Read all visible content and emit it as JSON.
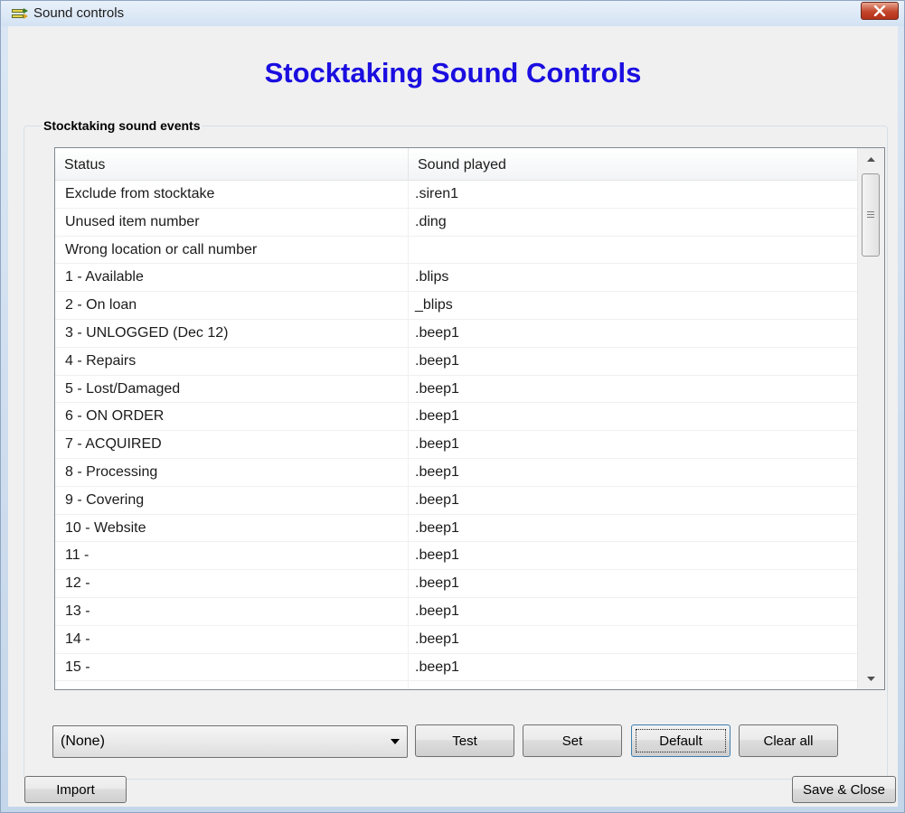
{
  "window": {
    "title": "Sound controls"
  },
  "heading": "Stocktaking Sound Controls",
  "group": {
    "label": "Stocktaking sound events"
  },
  "table": {
    "columns": [
      "Status",
      "Sound played"
    ],
    "rows": [
      {
        "status": "Exclude from stocktake",
        "sound": ".siren1"
      },
      {
        "status": "Unused item number",
        "sound": ".ding"
      },
      {
        "status": "Wrong location or call number",
        "sound": ""
      },
      {
        "status": "1 - Available",
        "sound": ".blips"
      },
      {
        "status": "2 - On loan",
        "sound": "_blips"
      },
      {
        "status": "3 - UNLOGGED (Dec 12)",
        "sound": ".beep1"
      },
      {
        "status": "4 - Repairs",
        "sound": ".beep1"
      },
      {
        "status": "5 - Lost/Damaged",
        "sound": ".beep1"
      },
      {
        "status": "6 - ON ORDER",
        "sound": ".beep1"
      },
      {
        "status": "7 - ACQUIRED",
        "sound": ".beep1"
      },
      {
        "status": "8 - Processing",
        "sound": ".beep1"
      },
      {
        "status": "9 - Covering",
        "sound": ".beep1"
      },
      {
        "status": "10 - Website",
        "sound": ".beep1"
      },
      {
        "status": "11 -",
        "sound": ".beep1"
      },
      {
        "status": "12 -",
        "sound": ".beep1"
      },
      {
        "status": "13 -",
        "sound": ".beep1"
      },
      {
        "status": "14 -",
        "sound": ".beep1"
      },
      {
        "status": "15 -",
        "sound": ".beep1"
      }
    ]
  },
  "sound_select": {
    "value": "(None)"
  },
  "buttons": {
    "test": "Test",
    "set": "Set",
    "default": "Default",
    "clear_all": "Clear all",
    "import": "Import",
    "save_close": "Save & Close"
  },
  "colors": {
    "heading": "#1a0ee0",
    "close_button": "#c2452a",
    "dialog_background": "#f0f0f0"
  },
  "icons": {
    "app": "sound-controls-icon",
    "close": "close-icon",
    "combo_arrow": "chevron-down-icon",
    "scroll_up": "arrow-up-icon",
    "scroll_down": "arrow-down-icon"
  }
}
